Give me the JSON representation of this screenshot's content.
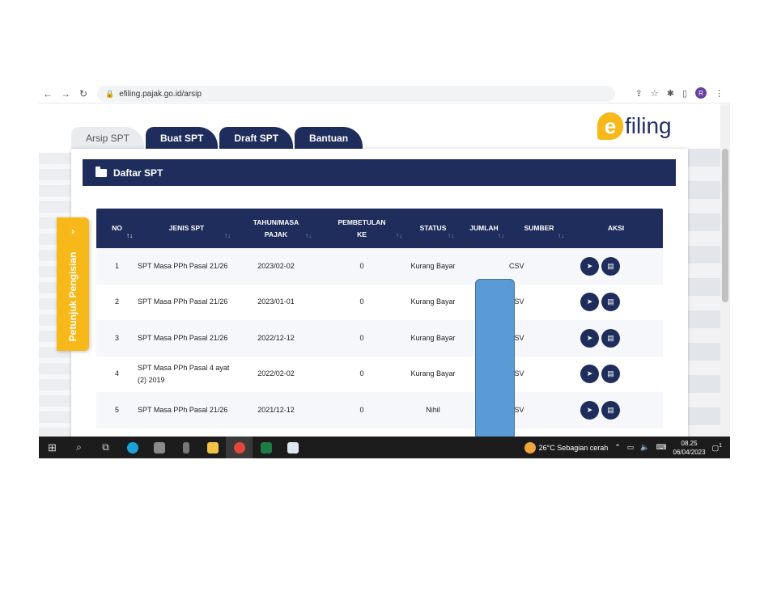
{
  "browser": {
    "url": "efiling.pajak.go.id/arsip",
    "avatar_letter": "R"
  },
  "logo": {
    "mark": "e",
    "text": "filing"
  },
  "tabs": [
    {
      "label": "Arsip SPT",
      "active": true
    },
    {
      "label": "Buat SPT",
      "active": false
    },
    {
      "label": "Draft SPT",
      "active": false
    },
    {
      "label": "Bantuan",
      "active": false
    }
  ],
  "panel": {
    "title": "Daftar SPT"
  },
  "side_tab": {
    "label": "Petunjuk Pengisian",
    "chevron": "›"
  },
  "table": {
    "headers": {
      "no": "NO",
      "jenis": "JENIS SPT",
      "tahun": "TAHUN/MASA PAJAK",
      "pembetulan": "PEMBETULAN KE",
      "status": "STATUS",
      "jumlah": "JUMLAH",
      "sumber": "SUMBER",
      "aksi": "AKSI"
    },
    "rows": [
      {
        "no": "1",
        "jenis": "SPT Masa PPh Pasal 21/26",
        "tahun": "2023/02-02",
        "pembetulan": "0",
        "status": "Kurang Bayar",
        "sumber": "CSV"
      },
      {
        "no": "2",
        "jenis": "SPT Masa PPh Pasal 21/26",
        "tahun": "2023/01-01",
        "pembetulan": "0",
        "status": "Kurang Bayar",
        "sumber": "CSV"
      },
      {
        "no": "3",
        "jenis": "SPT Masa PPh Pasal 21/26",
        "tahun": "2022/12-12",
        "pembetulan": "0",
        "status": "Kurang Bayar",
        "sumber": "CSV"
      },
      {
        "no": "4",
        "jenis": "SPT Masa PPh Pasal 4 ayat (2) 2019",
        "tahun": "2022/02-02",
        "pembetulan": "0",
        "status": "Kurang Bayar",
        "sumber": "CSV"
      },
      {
        "no": "5",
        "jenis": "SPT Masa PPh Pasal 21/26",
        "tahun": "2021/12-12",
        "pembetulan": "0",
        "status": "Nihil",
        "sumber": "CSV"
      }
    ]
  },
  "taskbar": {
    "weather": "26°C  Sebagian cerah",
    "time": "08.25",
    "date": "06/04/2023",
    "notification_count": "1"
  },
  "colors": {
    "navy": "#1f2d5c",
    "accent_yellow": "#f7b81a",
    "redaction_blue": "#5b9bd5"
  }
}
